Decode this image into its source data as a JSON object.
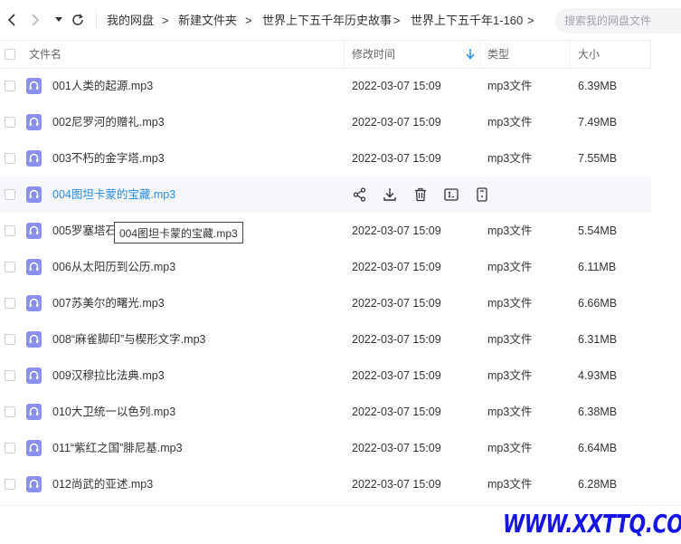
{
  "nav": {
    "back_icon": "chevron-left-icon",
    "forward_icon": "chevron-right-icon",
    "dropdown_icon": "caret-down-icon",
    "refresh_icon": "refresh-icon"
  },
  "breadcrumb": {
    "items": [
      "我的网盘",
      "新建文件夹",
      "世界上下五千年历史故事",
      "世界上下五千年1-160"
    ],
    "separator": ">"
  },
  "search": {
    "placeholder": "搜索我的网盘文件"
  },
  "columns": {
    "name": "文件名",
    "modified": "修改时间",
    "type": "类型",
    "size": "大小",
    "sort_icon": "arrow-down-icon"
  },
  "files": [
    {
      "name": "001人类的起源.mp3",
      "date": "2022-03-07 15:09",
      "type": "mp3文件",
      "size": "6.39MB"
    },
    {
      "name": "002尼罗河的赠礼.mp3",
      "date": "2022-03-07 15:09",
      "type": "mp3文件",
      "size": "7.49MB"
    },
    {
      "name": "003不朽的金字塔.mp3",
      "date": "2022-03-07 15:09",
      "type": "mp3文件",
      "size": "7.55MB"
    },
    {
      "name": "004图坦卡蒙的宝藏.mp3",
      "date": "",
      "type": "",
      "size": ""
    },
    {
      "name": "005罗塞塔石",
      "date": "2022-03-07 15:09",
      "type": "mp3文件",
      "size": "5.54MB"
    },
    {
      "name": "006从太阳历到公历.mp3",
      "date": "2022-03-07 15:09",
      "type": "mp3文件",
      "size": "6.11MB"
    },
    {
      "name": "007苏美尔的曙光.mp3",
      "date": "2022-03-07 15:09",
      "type": "mp3文件",
      "size": "6.66MB"
    },
    {
      "name": "008“麻雀脚印”与楔形文字.mp3",
      "date": "2022-03-07 15:09",
      "type": "mp3文件",
      "size": "6.31MB"
    },
    {
      "name": "009汉穆拉比法典.mp3",
      "date": "2022-03-07 15:09",
      "type": "mp3文件",
      "size": "4.93MB"
    },
    {
      "name": "010大卫统一以色列.mp3",
      "date": "2022-03-07 15:09",
      "type": "mp3文件",
      "size": "6.38MB"
    },
    {
      "name": "011“紫红之国”腓尼基.mp3",
      "date": "2022-03-07 15:09",
      "type": "mp3文件",
      "size": "6.64MB"
    },
    {
      "name": "012尚武的亚述.mp3",
      "date": "2022-03-07 15:09",
      "type": "mp3文件",
      "size": "6.28MB"
    }
  ],
  "hover_actions": [
    "share-icon",
    "download-icon",
    "delete-icon",
    "rename-icon",
    "more-icon"
  ],
  "tooltip": {
    "text": "004图坦卡蒙的宝藏.mp3"
  },
  "watermark": {
    "text": "WWW.XXTTQ.COM"
  },
  "colors": {
    "accent": "#2a8ce0",
    "file_icon": "#8a8ff0",
    "watermark": "#1414e6"
  }
}
